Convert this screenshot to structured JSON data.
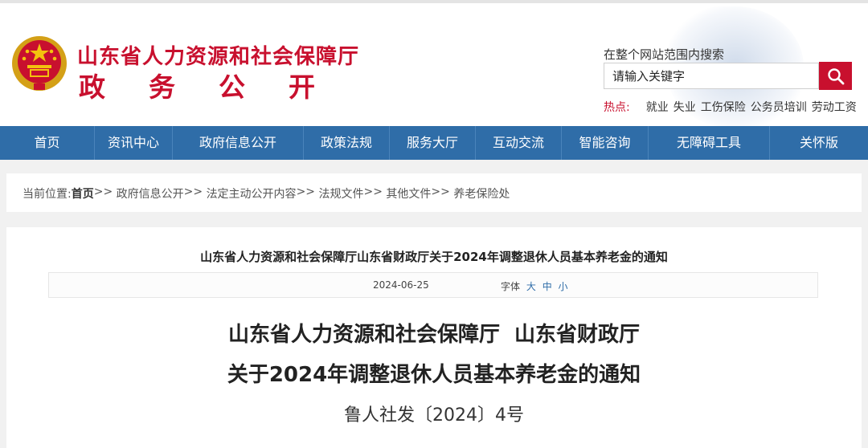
{
  "header": {
    "site_name": "山东省人力资源和社会保障厅",
    "site_sub": "政务公开",
    "search_label": "在整个网站范围内搜索",
    "search_placeholder": "请输入关键字",
    "hot_label": "热点:",
    "hot_items": [
      "就业",
      "失业",
      "工伤保险",
      "公务员培训",
      "劳动工资"
    ]
  },
  "colors": {
    "brand_red": "#c8102e",
    "nav_blue": "#2f6da8"
  },
  "icons": {
    "emblem": "national-emblem-icon",
    "search": "search-icon"
  },
  "nav": [
    "首页",
    "资讯中心",
    "政府信息公开",
    "政策法规",
    "服务大厅",
    "互动交流",
    "智能咨询",
    "无障碍工具",
    "关怀版"
  ],
  "breadcrumb": {
    "prefix": "当前位置: ",
    "items": [
      "首页",
      "政府信息公开",
      "法定主动公开内容",
      "法规文件",
      "其他文件",
      "养老保险处"
    ],
    "separator": ">>"
  },
  "article": {
    "title": "山东省人力资源和社会保障厅山东省财政厅关于2024年调整退休人员基本养老金的通知",
    "date": "2024-06-25",
    "font_label": "字体",
    "font_sizes": [
      "大",
      "中",
      "小"
    ],
    "doc_line1": "山东省人力资源和社会保障厅  山东省财政厅",
    "doc_line2": "关于2024年调整退休人员基本养老金的通知",
    "doc_number": "鲁人社发〔2024〕4号"
  }
}
